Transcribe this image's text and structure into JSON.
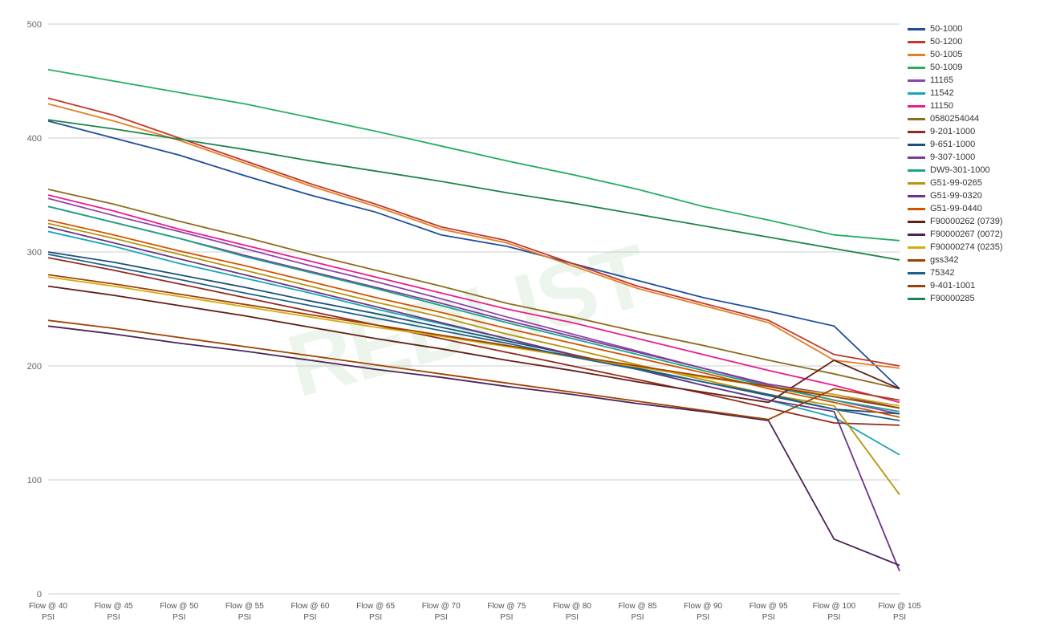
{
  "chart": {
    "title": "",
    "watermark": "REDLIST",
    "xLabels": [
      "Flow @ 40\nPSI",
      "Flow @ 45\nPSI",
      "Flow @ 50\nPSI",
      "Flow @ 55\nPSI",
      "Flow @ 60\nPSI",
      "Flow @ 65\nPSI",
      "Flow @ 70\nPSI",
      "Flow @ 75\nPSI",
      "Flow @ 80\nPSI",
      "Flow @ 85\nPSI",
      "Flow @ 90\nPSI",
      "Flow @ 95\nPSI",
      "Flow @ 100\nPSI",
      "Flow @ 105\nPSI"
    ],
    "yTicks": [
      0,
      100,
      200,
      300,
      400,
      500
    ],
    "series": [
      {
        "id": "50-1000",
        "color": "#1f4e9e",
        "values": [
          415,
          400,
          385,
          367,
          350,
          335,
          315,
          305,
          290,
          275,
          260,
          248,
          235,
          180
        ]
      },
      {
        "id": "50-1200",
        "color": "#c0392b",
        "values": [
          435,
          420,
          400,
          380,
          360,
          342,
          322,
          310,
          290,
          270,
          255,
          240,
          210,
          200
        ]
      },
      {
        "id": "50-1005",
        "color": "#e67e22",
        "values": [
          430,
          415,
          398,
          378,
          358,
          340,
          320,
          308,
          288,
          268,
          253,
          238,
          205,
          198
        ]
      },
      {
        "id": "50-1009",
        "color": "#27ae60",
        "values": [
          460,
          450,
          440,
          430,
          418,
          406,
          393,
          380,
          368,
          355,
          340,
          328,
          315,
          310
        ]
      },
      {
        "id": "11165",
        "color": "#8e44ad",
        "values": [
          347,
          332,
          318,
          303,
          288,
          274,
          259,
          243,
          228,
          213,
          198,
          183,
          170,
          158
        ]
      },
      {
        "id": "11542",
        "color": "#16a6b6",
        "values": [
          318,
          305,
          290,
          277,
          264,
          250,
          237,
          224,
          210,
          197,
          183,
          170,
          155,
          122
        ]
      },
      {
        "id": "11150",
        "color": "#e91e8c",
        "values": [
          350,
          336,
          320,
          306,
          292,
          278,
          264,
          250,
          238,
          224,
          210,
          196,
          183,
          168
        ]
      },
      {
        "id": "0580254044",
        "color": "#8c6d1f",
        "values": [
          355,
          342,
          327,
          313,
          298,
          284,
          270,
          255,
          243,
          230,
          218,
          205,
          193,
          180
        ]
      },
      {
        "id": "9-201-1000",
        "color": "#922b21",
        "values": [
          295,
          284,
          272,
          260,
          248,
          236,
          224,
          212,
          200,
          188,
          176,
          163,
          150,
          148
        ]
      },
      {
        "id": "9-651-1000",
        "color": "#1a5276",
        "values": [
          300,
          291,
          280,
          269,
          257,
          246,
          234,
          222,
          210,
          198,
          186,
          174,
          162,
          158
        ]
      },
      {
        "id": "9-307-1000",
        "color": "#7d3c98",
        "values": [
          340,
          326,
          312,
          297,
          283,
          269,
          255,
          240,
          226,
          212,
          198,
          184,
          175,
          163
        ]
      },
      {
        "id": "DW9-301-1000",
        "color": "#17a589",
        "values": [
          340,
          326,
          312,
          296,
          282,
          268,
          253,
          238,
          224,
          210,
          196,
          182,
          170,
          160
        ]
      },
      {
        "id": "G51-99-0265",
        "color": "#b7950b",
        "values": [
          325,
          312,
          298,
          284,
          270,
          256,
          243,
          228,
          215,
          201,
          188,
          175,
          165,
          87
        ]
      },
      {
        "id": "G51-99-0320",
        "color": "#6c3483",
        "values": [
          322,
          308,
          294,
          280,
          266,
          252,
          238,
          224,
          210,
          197,
          183,
          170,
          160,
          20
        ]
      },
      {
        "id": "G51-99-0440",
        "color": "#d35400",
        "values": [
          328,
          315,
          301,
          288,
          274,
          260,
          247,
          233,
          220,
          207,
          194,
          180,
          168,
          155
        ]
      },
      {
        "id": "F90000262 (0739)",
        "color": "#641e16",
        "values": [
          270,
          262,
          253,
          244,
          234,
          224,
          215,
          205,
          196,
          186,
          177,
          168,
          205,
          180
        ]
      },
      {
        "id": "F90000267 (0072)",
        "color": "#4a235a",
        "values": [
          235,
          228,
          220,
          213,
          205,
          197,
          190,
          182,
          175,
          167,
          160,
          152,
          48,
          25
        ]
      },
      {
        "id": "F90000274 (0235)",
        "color": "#d4ac0d",
        "values": [
          278,
          270,
          261,
          252,
          243,
          234,
          226,
          217,
          208,
          199,
          190,
          182,
          175,
          165
        ]
      },
      {
        "id": "gss342",
        "color": "#a04000",
        "values": [
          280,
          272,
          263,
          254,
          245,
          236,
          227,
          218,
          209,
          200,
          191,
          182,
          173,
          163
        ]
      },
      {
        "id": "75342",
        "color": "#1f618d",
        "values": [
          298,
          287,
          276,
          264,
          253,
          242,
          231,
          220,
          208,
          197,
          186,
          175,
          162,
          152
        ]
      },
      {
        "id": "9-401-1001",
        "color": "#a04000",
        "values": [
          240,
          233,
          225,
          217,
          209,
          201,
          193,
          185,
          177,
          169,
          161,
          153,
          180,
          170
        ]
      },
      {
        "id": "F90000285",
        "color": "#1e8449",
        "values": [
          416,
          408,
          399,
          390,
          380,
          371,
          362,
          352,
          343,
          333,
          323,
          313,
          303,
          293
        ]
      }
    ]
  }
}
